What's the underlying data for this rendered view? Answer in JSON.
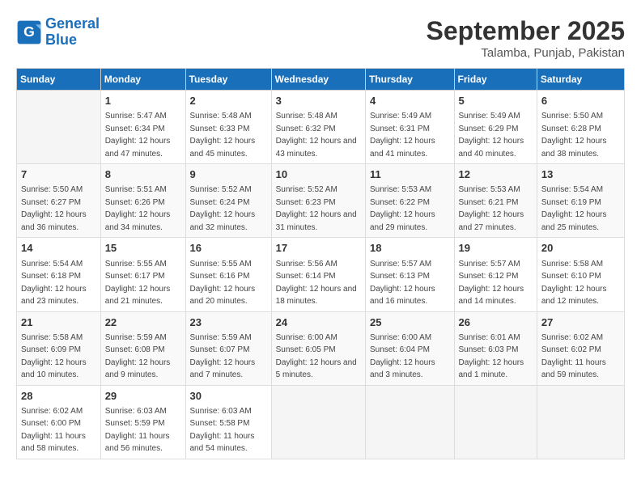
{
  "app": {
    "logo_line1": "General",
    "logo_line2": "Blue"
  },
  "title": "September 2025",
  "location": "Talamba, Punjab, Pakistan",
  "weekdays": [
    "Sunday",
    "Monday",
    "Tuesday",
    "Wednesday",
    "Thursday",
    "Friday",
    "Saturday"
  ],
  "weeks": [
    [
      {
        "day": "",
        "sunrise": "",
        "sunset": "",
        "daylight": ""
      },
      {
        "day": "1",
        "sunrise": "Sunrise: 5:47 AM",
        "sunset": "Sunset: 6:34 PM",
        "daylight": "Daylight: 12 hours and 47 minutes."
      },
      {
        "day": "2",
        "sunrise": "Sunrise: 5:48 AM",
        "sunset": "Sunset: 6:33 PM",
        "daylight": "Daylight: 12 hours and 45 minutes."
      },
      {
        "day": "3",
        "sunrise": "Sunrise: 5:48 AM",
        "sunset": "Sunset: 6:32 PM",
        "daylight": "Daylight: 12 hours and 43 minutes."
      },
      {
        "day": "4",
        "sunrise": "Sunrise: 5:49 AM",
        "sunset": "Sunset: 6:31 PM",
        "daylight": "Daylight: 12 hours and 41 minutes."
      },
      {
        "day": "5",
        "sunrise": "Sunrise: 5:49 AM",
        "sunset": "Sunset: 6:29 PM",
        "daylight": "Daylight: 12 hours and 40 minutes."
      },
      {
        "day": "6",
        "sunrise": "Sunrise: 5:50 AM",
        "sunset": "Sunset: 6:28 PM",
        "daylight": "Daylight: 12 hours and 38 minutes."
      }
    ],
    [
      {
        "day": "7",
        "sunrise": "Sunrise: 5:50 AM",
        "sunset": "Sunset: 6:27 PM",
        "daylight": "Daylight: 12 hours and 36 minutes."
      },
      {
        "day": "8",
        "sunrise": "Sunrise: 5:51 AM",
        "sunset": "Sunset: 6:26 PM",
        "daylight": "Daylight: 12 hours and 34 minutes."
      },
      {
        "day": "9",
        "sunrise": "Sunrise: 5:52 AM",
        "sunset": "Sunset: 6:24 PM",
        "daylight": "Daylight: 12 hours and 32 minutes."
      },
      {
        "day": "10",
        "sunrise": "Sunrise: 5:52 AM",
        "sunset": "Sunset: 6:23 PM",
        "daylight": "Daylight: 12 hours and 31 minutes."
      },
      {
        "day": "11",
        "sunrise": "Sunrise: 5:53 AM",
        "sunset": "Sunset: 6:22 PM",
        "daylight": "Daylight: 12 hours and 29 minutes."
      },
      {
        "day": "12",
        "sunrise": "Sunrise: 5:53 AM",
        "sunset": "Sunset: 6:21 PM",
        "daylight": "Daylight: 12 hours and 27 minutes."
      },
      {
        "day": "13",
        "sunrise": "Sunrise: 5:54 AM",
        "sunset": "Sunset: 6:19 PM",
        "daylight": "Daylight: 12 hours and 25 minutes."
      }
    ],
    [
      {
        "day": "14",
        "sunrise": "Sunrise: 5:54 AM",
        "sunset": "Sunset: 6:18 PM",
        "daylight": "Daylight: 12 hours and 23 minutes."
      },
      {
        "day": "15",
        "sunrise": "Sunrise: 5:55 AM",
        "sunset": "Sunset: 6:17 PM",
        "daylight": "Daylight: 12 hours and 21 minutes."
      },
      {
        "day": "16",
        "sunrise": "Sunrise: 5:55 AM",
        "sunset": "Sunset: 6:16 PM",
        "daylight": "Daylight: 12 hours and 20 minutes."
      },
      {
        "day": "17",
        "sunrise": "Sunrise: 5:56 AM",
        "sunset": "Sunset: 6:14 PM",
        "daylight": "Daylight: 12 hours and 18 minutes."
      },
      {
        "day": "18",
        "sunrise": "Sunrise: 5:57 AM",
        "sunset": "Sunset: 6:13 PM",
        "daylight": "Daylight: 12 hours and 16 minutes."
      },
      {
        "day": "19",
        "sunrise": "Sunrise: 5:57 AM",
        "sunset": "Sunset: 6:12 PM",
        "daylight": "Daylight: 12 hours and 14 minutes."
      },
      {
        "day": "20",
        "sunrise": "Sunrise: 5:58 AM",
        "sunset": "Sunset: 6:10 PM",
        "daylight": "Daylight: 12 hours and 12 minutes."
      }
    ],
    [
      {
        "day": "21",
        "sunrise": "Sunrise: 5:58 AM",
        "sunset": "Sunset: 6:09 PM",
        "daylight": "Daylight: 12 hours and 10 minutes."
      },
      {
        "day": "22",
        "sunrise": "Sunrise: 5:59 AM",
        "sunset": "Sunset: 6:08 PM",
        "daylight": "Daylight: 12 hours and 9 minutes."
      },
      {
        "day": "23",
        "sunrise": "Sunrise: 5:59 AM",
        "sunset": "Sunset: 6:07 PM",
        "daylight": "Daylight: 12 hours and 7 minutes."
      },
      {
        "day": "24",
        "sunrise": "Sunrise: 6:00 AM",
        "sunset": "Sunset: 6:05 PM",
        "daylight": "Daylight: 12 hours and 5 minutes."
      },
      {
        "day": "25",
        "sunrise": "Sunrise: 6:00 AM",
        "sunset": "Sunset: 6:04 PM",
        "daylight": "Daylight: 12 hours and 3 minutes."
      },
      {
        "day": "26",
        "sunrise": "Sunrise: 6:01 AM",
        "sunset": "Sunset: 6:03 PM",
        "daylight": "Daylight: 12 hours and 1 minute."
      },
      {
        "day": "27",
        "sunrise": "Sunrise: 6:02 AM",
        "sunset": "Sunset: 6:02 PM",
        "daylight": "Daylight: 11 hours and 59 minutes."
      }
    ],
    [
      {
        "day": "28",
        "sunrise": "Sunrise: 6:02 AM",
        "sunset": "Sunset: 6:00 PM",
        "daylight": "Daylight: 11 hours and 58 minutes."
      },
      {
        "day": "29",
        "sunrise": "Sunrise: 6:03 AM",
        "sunset": "Sunset: 5:59 PM",
        "daylight": "Daylight: 11 hours and 56 minutes."
      },
      {
        "day": "30",
        "sunrise": "Sunrise: 6:03 AM",
        "sunset": "Sunset: 5:58 PM",
        "daylight": "Daylight: 11 hours and 54 minutes."
      },
      {
        "day": "",
        "sunrise": "",
        "sunset": "",
        "daylight": ""
      },
      {
        "day": "",
        "sunrise": "",
        "sunset": "",
        "daylight": ""
      },
      {
        "day": "",
        "sunrise": "",
        "sunset": "",
        "daylight": ""
      },
      {
        "day": "",
        "sunrise": "",
        "sunset": "",
        "daylight": ""
      }
    ]
  ]
}
